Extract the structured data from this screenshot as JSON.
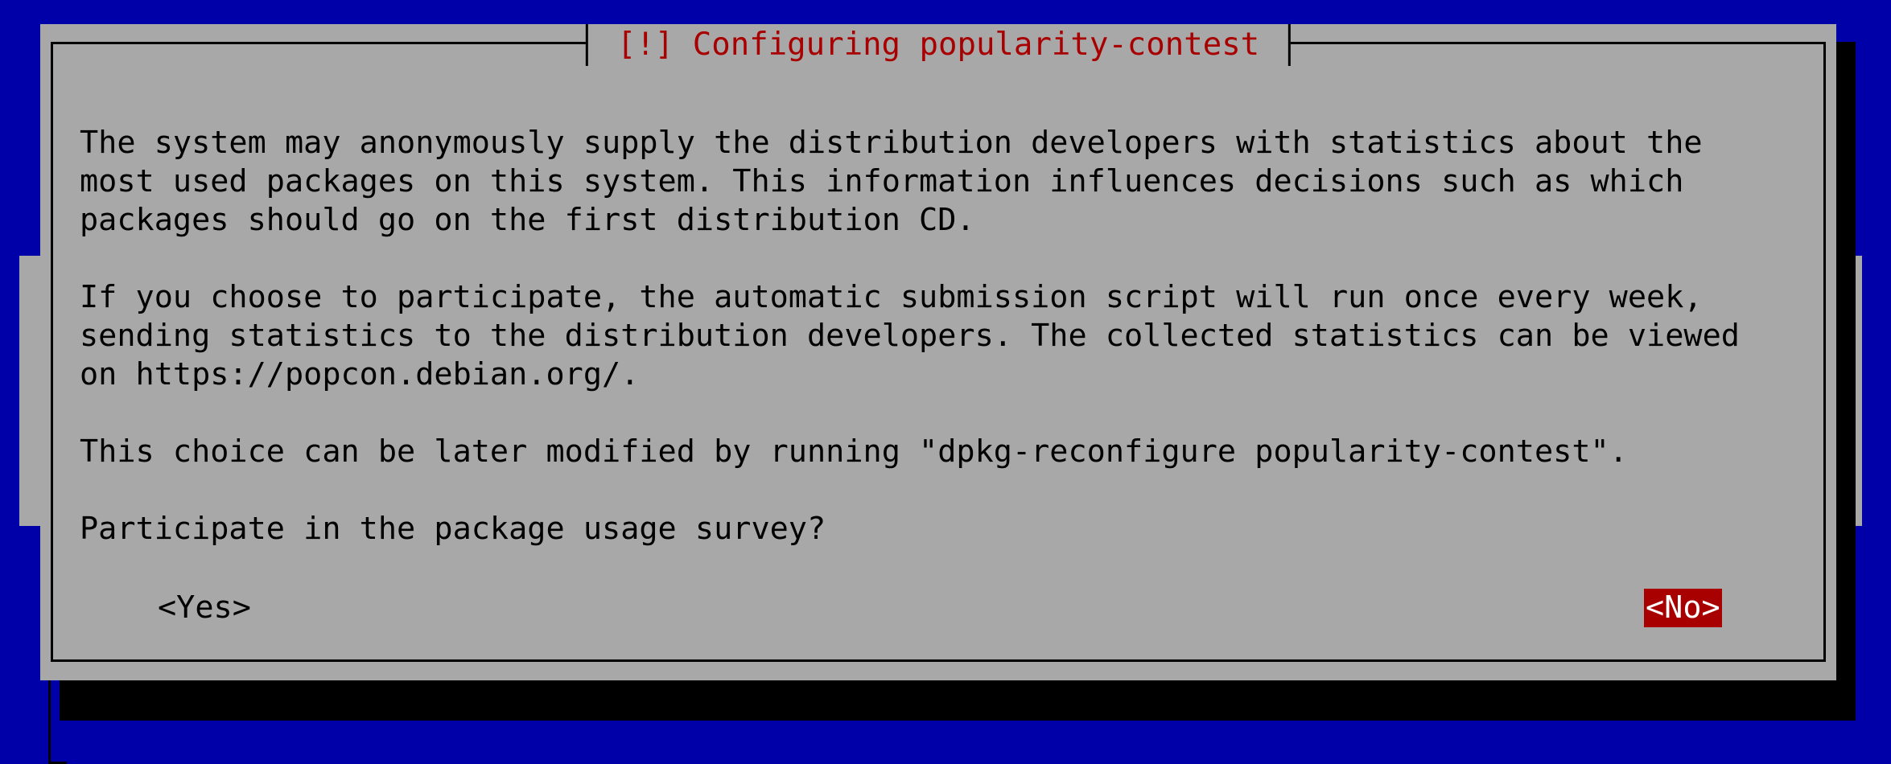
{
  "dialog": {
    "title": "[!] Configuring popularity-contest",
    "lines": [
      "The system may anonymously supply the distribution developers with statistics about the",
      "most used packages on this system. This information influences decisions such as which",
      "packages should go on the first distribution CD.",
      "",
      "If you choose to participate, the automatic submission script will run once every week,",
      "sending statistics to the distribution developers. The collected statistics can be viewed",
      "on https://popcon.debian.org/.",
      "",
      "This choice can be later modified by running \"dpkg-reconfigure popularity-contest\".",
      "",
      "Participate in the package usage survey?"
    ],
    "yes_label": "<Yes>",
    "no_label": "<No>",
    "selected_button": "No"
  },
  "colors": {
    "background": "#0000a8",
    "dialog": "#a8a8a8",
    "title_text": "#a80000",
    "selected_button_bg": "#a80000",
    "selected_button_text": "#ffffff",
    "text": "#000000"
  }
}
